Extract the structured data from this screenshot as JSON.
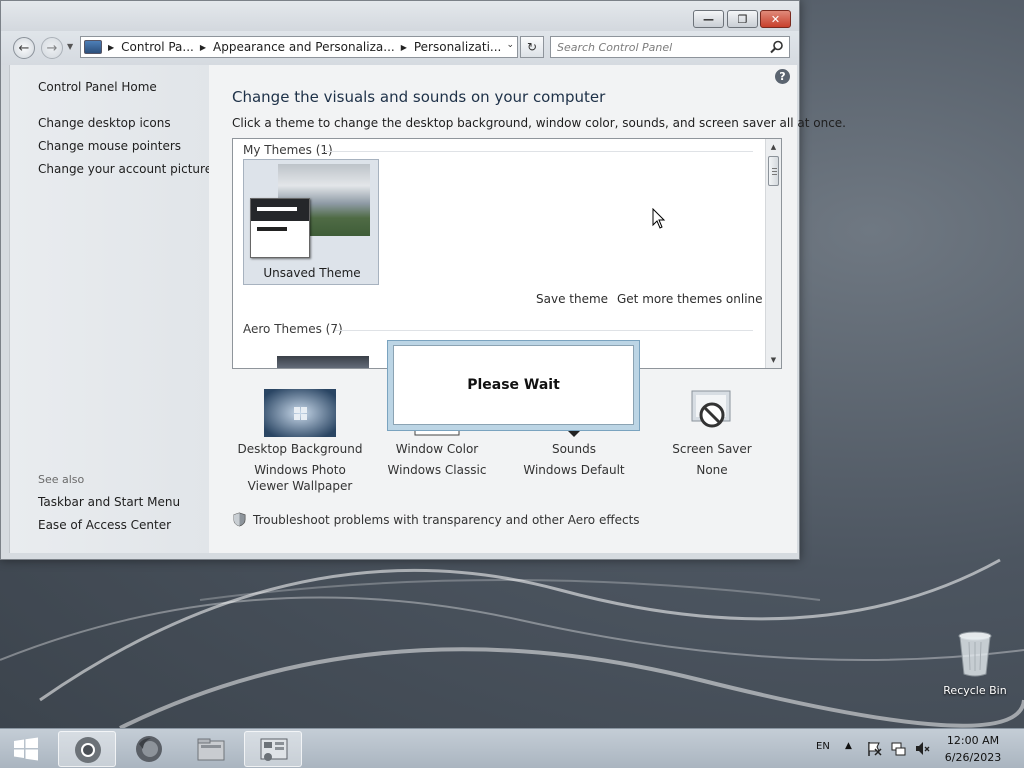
{
  "window": {
    "minimize_glyph": "—",
    "maximize_glyph": "❐",
    "close_glyph": "✕"
  },
  "address": {
    "back_glyph": "←",
    "forward_glyph": "→",
    "refresh_glyph": "↻",
    "breadcrumbs": [
      "Control Pa...",
      "Appearance and Personaliza...",
      "Personalizati..."
    ],
    "search_placeholder": "Search Control Panel"
  },
  "sidebar": {
    "home": "Control Panel Home",
    "links": [
      "Change desktop icons",
      "Change mouse pointers",
      "Change your account picture"
    ],
    "see_also_label": "See also",
    "see_also": [
      "Taskbar and Start Menu",
      "Ease of Access Center"
    ]
  },
  "content": {
    "help_glyph": "?",
    "heading": "Change the visuals and sounds on your computer",
    "subtext": "Click a theme to change the desktop background, window color, sounds, and screen saver all at once.",
    "my_themes_label": "My Themes (1)",
    "unsaved_theme": "Unsaved Theme",
    "save_theme": "Save theme",
    "get_more": "Get more themes online",
    "aero_themes_label": "Aero Themes (7)",
    "settings": [
      {
        "label": "Desktop Background",
        "value": "Windows Photo Viewer Wallpaper"
      },
      {
        "label": "Window Color",
        "value": "Windows Classic"
      },
      {
        "label": "Sounds",
        "value": "Windows Default"
      },
      {
        "label": "Screen Saver",
        "value": "None"
      }
    ],
    "troubleshoot": "Troubleshoot problems with transparency and other Aero effects"
  },
  "dialog": {
    "text": "Please Wait"
  },
  "desktop": {
    "recycle_bin": "Recycle Bin"
  },
  "taskbar": {
    "language": "EN",
    "tray_arrow": "▲",
    "time": "12:00 AM",
    "date": "6/26/2023"
  },
  "colors": {
    "heading": "#1e3148",
    "accent": "#7aa3bf"
  }
}
